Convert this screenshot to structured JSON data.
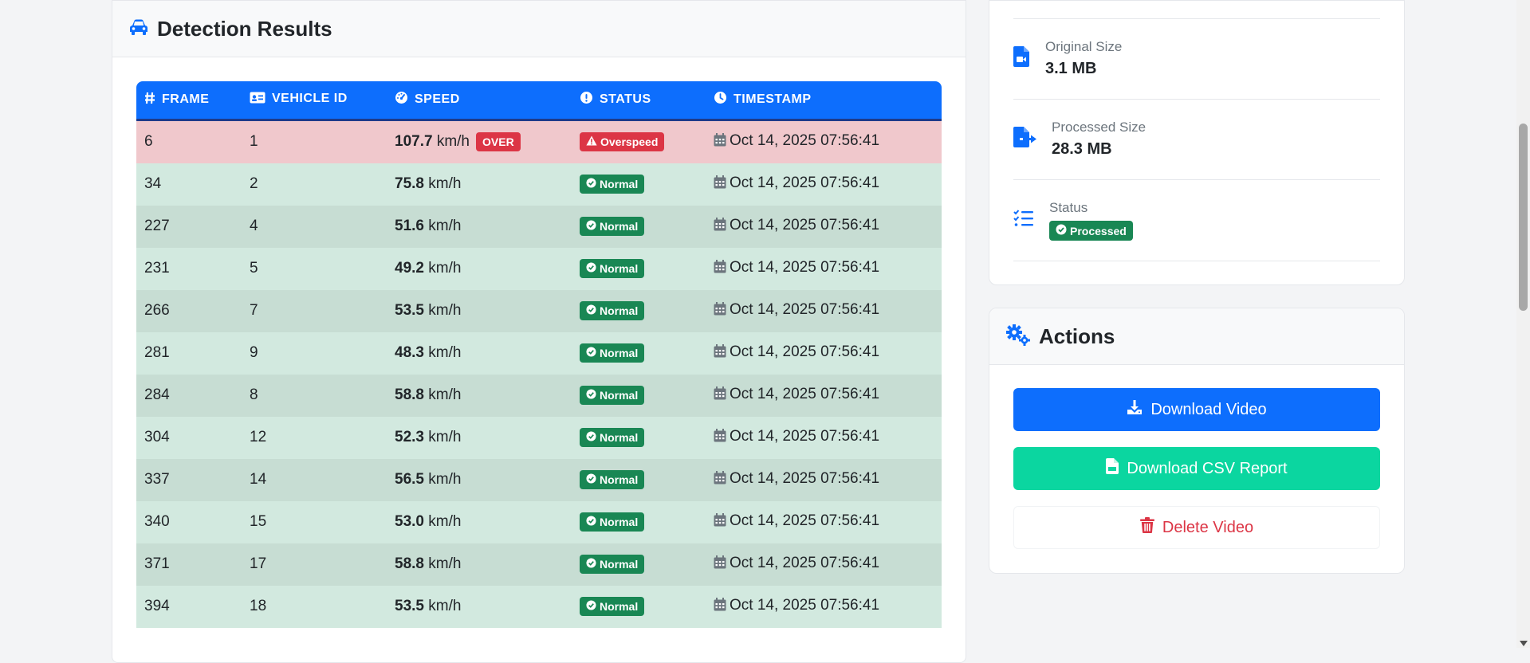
{
  "detection": {
    "title": "Detection Results",
    "columns": {
      "frame": "FRAME",
      "vehicle_id": "VEHICLE ID",
      "speed": "SPEED",
      "status": "STATUS",
      "timestamp": "TIMESTAMP"
    },
    "speed_unit": "km/h",
    "over_label": "OVER",
    "rows": [
      {
        "frame": "6",
        "vehicle_id": "1",
        "speed": "107.7",
        "status": "Overspeed",
        "over": true,
        "timestamp": "Oct 14, 2025 07:56:41"
      },
      {
        "frame": "34",
        "vehicle_id": "2",
        "speed": "75.8",
        "status": "Normal",
        "over": false,
        "timestamp": "Oct 14, 2025 07:56:41"
      },
      {
        "frame": "227",
        "vehicle_id": "4",
        "speed": "51.6",
        "status": "Normal",
        "over": false,
        "timestamp": "Oct 14, 2025 07:56:41"
      },
      {
        "frame": "231",
        "vehicle_id": "5",
        "speed": "49.2",
        "status": "Normal",
        "over": false,
        "timestamp": "Oct 14, 2025 07:56:41"
      },
      {
        "frame": "266",
        "vehicle_id": "7",
        "speed": "53.5",
        "status": "Normal",
        "over": false,
        "timestamp": "Oct 14, 2025 07:56:41"
      },
      {
        "frame": "281",
        "vehicle_id": "9",
        "speed": "48.3",
        "status": "Normal",
        "over": false,
        "timestamp": "Oct 14, 2025 07:56:41"
      },
      {
        "frame": "284",
        "vehicle_id": "8",
        "speed": "58.8",
        "status": "Normal",
        "over": false,
        "timestamp": "Oct 14, 2025 07:56:41"
      },
      {
        "frame": "304",
        "vehicle_id": "12",
        "speed": "52.3",
        "status": "Normal",
        "over": false,
        "timestamp": "Oct 14, 2025 07:56:41"
      },
      {
        "frame": "337",
        "vehicle_id": "14",
        "speed": "56.5",
        "status": "Normal",
        "over": false,
        "timestamp": "Oct 14, 2025 07:56:41"
      },
      {
        "frame": "340",
        "vehicle_id": "15",
        "speed": "53.0",
        "status": "Normal",
        "over": false,
        "timestamp": "Oct 14, 2025 07:56:41"
      },
      {
        "frame": "371",
        "vehicle_id": "17",
        "speed": "58.8",
        "status": "Normal",
        "over": false,
        "timestamp": "Oct 14, 2025 07:56:41"
      },
      {
        "frame": "394",
        "vehicle_id": "18",
        "speed": "53.5",
        "status": "Normal",
        "over": false,
        "timestamp": "Oct 14, 2025 07:56:41"
      }
    ]
  },
  "file_info": {
    "original_size_label": "Original Size",
    "original_size_value": "3.1 MB",
    "processed_size_label": "Processed Size",
    "processed_size_value": "28.3 MB",
    "status_label": "Status",
    "status_value": "Processed"
  },
  "actions": {
    "title": "Actions",
    "download_video": "Download Video",
    "download_csv": "Download CSV Report",
    "delete_video": "Delete Video"
  },
  "colors": {
    "primary": "#0d6efd",
    "success": "#198754",
    "teal": "#0bd6a0",
    "danger": "#dc3545",
    "row_danger": "#f0c8cc",
    "row_normal": "#d2e9df"
  },
  "icons": {
    "title": "car-icon",
    "frame": "hashtag-icon",
    "vehicle_id": "id-card-icon",
    "speed": "gauge-icon",
    "status": "list-check-icon",
    "timestamp": "clock-icon",
    "row_timestamp": "calendar-icon",
    "original_size": "file-video-icon",
    "processed_size": "file-export-icon",
    "actions": "gears-icon",
    "download": "download-icon",
    "csv": "file-csv-icon",
    "delete": "trash-icon"
  }
}
